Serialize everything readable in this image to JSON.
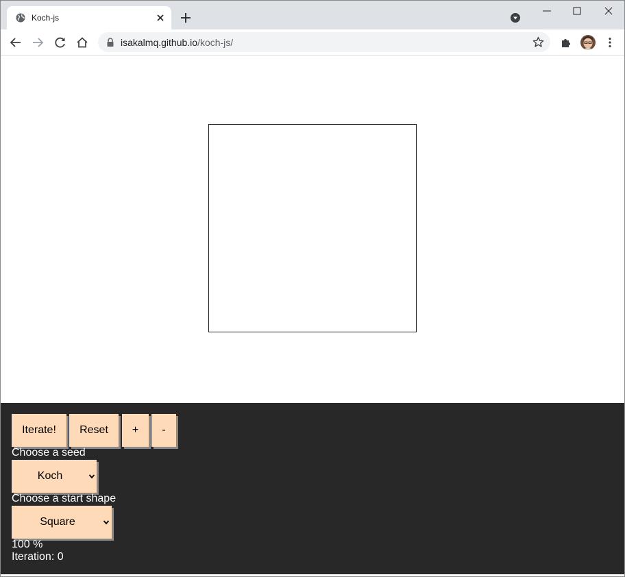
{
  "browser": {
    "tab": {
      "title": "Koch-js"
    },
    "address": {
      "host": "isakalmq.github.io",
      "path": "/koch-js/"
    }
  },
  "controls": {
    "buttons": {
      "iterate": "Iterate!",
      "reset": "Reset",
      "zoom_in": "+",
      "zoom_out": "-"
    },
    "seed": {
      "label": "Choose a seed",
      "selected": "Koch"
    },
    "start_shape": {
      "label": "Choose a start shape",
      "selected": "Square"
    },
    "zoom_text": "100 %",
    "iteration_text": "Iteration: 0"
  },
  "colors": {
    "button_bg": "#ffdab9",
    "panel_bg": "#282828",
    "shape_stroke": "#222222"
  }
}
